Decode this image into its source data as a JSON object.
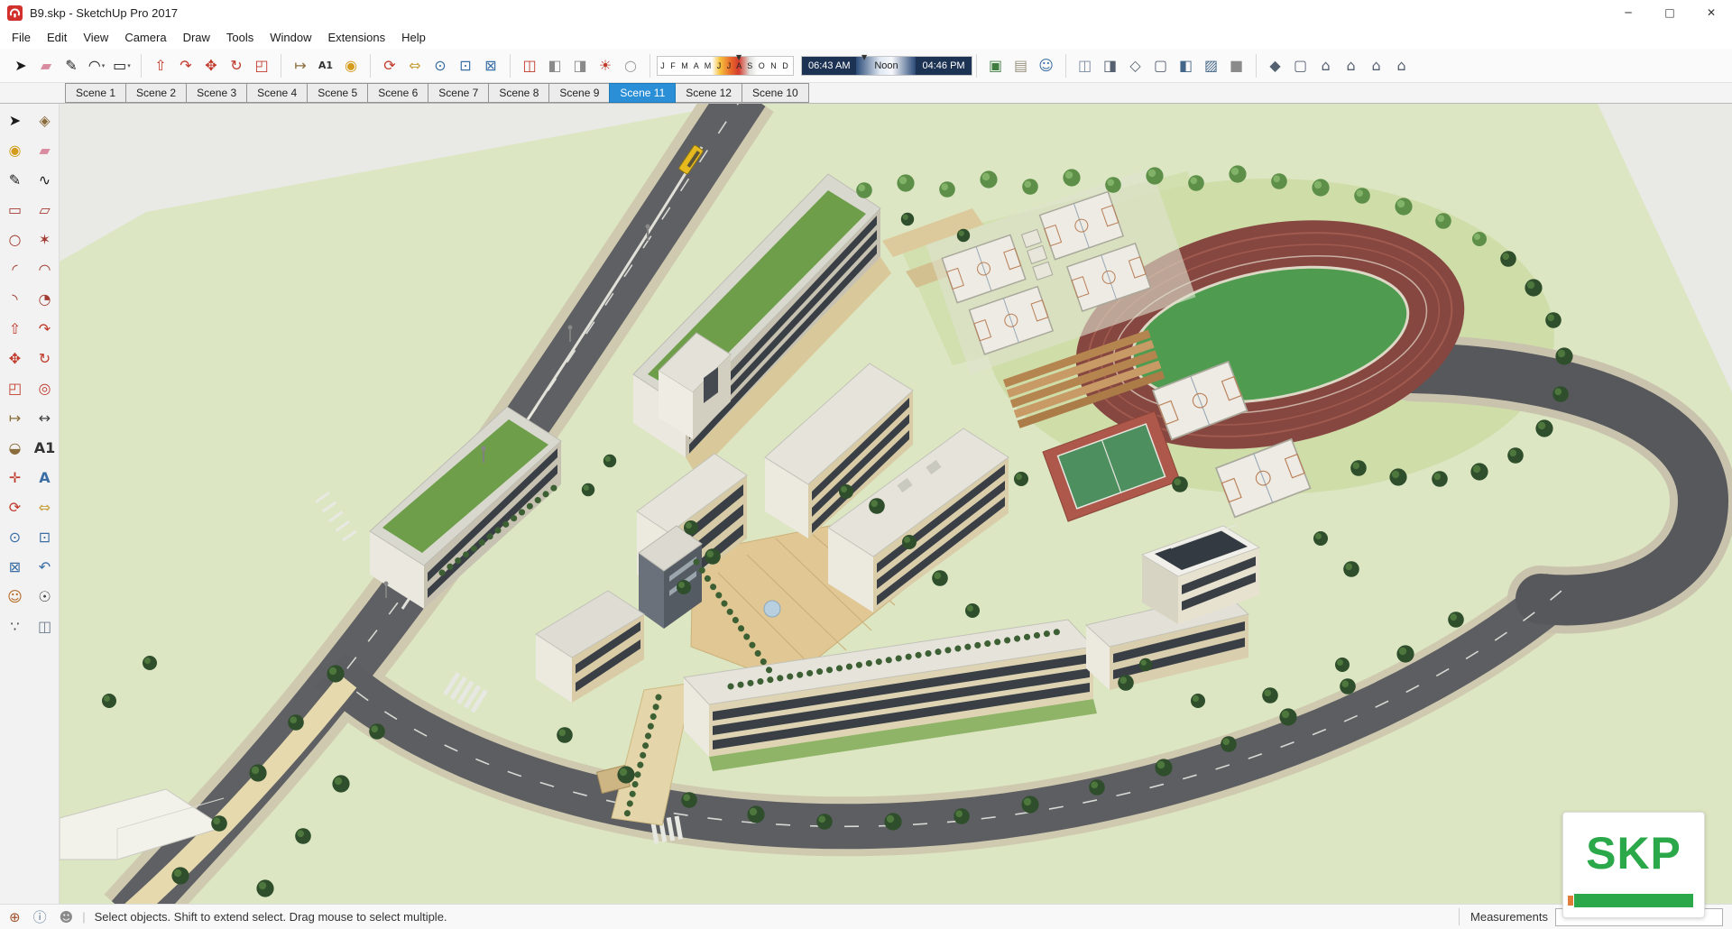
{
  "window": {
    "title": "B9.skp - SketchUp Pro 2017",
    "controls": [
      {
        "name": "minimize-button",
        "glyph": "─"
      },
      {
        "name": "maximize-button",
        "glyph": "□"
      },
      {
        "name": "close-button",
        "glyph": "✕"
      }
    ]
  },
  "menu_bar": {
    "items": [
      {
        "name": "menu-file",
        "label": "File"
      },
      {
        "name": "menu-edit",
        "label": "Edit"
      },
      {
        "name": "menu-view",
        "label": "View"
      },
      {
        "name": "menu-camera",
        "label": "Camera"
      },
      {
        "name": "menu-draw",
        "label": "Draw"
      },
      {
        "name": "menu-tools",
        "label": "Tools"
      },
      {
        "name": "menu-window",
        "label": "Window"
      },
      {
        "name": "menu-extensions",
        "label": "Extensions"
      },
      {
        "name": "menu-help",
        "label": "Help"
      }
    ]
  },
  "top_toolbar": {
    "basic": [
      {
        "name": "select-tool",
        "glyph": "➤",
        "color": "#1a1a1a"
      },
      {
        "name": "eraser-tool",
        "glyph": "▰",
        "color": "#d98ca0"
      },
      {
        "name": "line-tool",
        "glyph": "✎",
        "color": "#1a1a1a"
      },
      {
        "name": "arc-tool",
        "glyph": "◠",
        "color": "#1a1a1a",
        "caret": "▾"
      },
      {
        "name": "shapes-tool",
        "glyph": "▭",
        "color": "#1a1a1a",
        "caret": "▾"
      }
    ],
    "modify": [
      {
        "name": "push-pull-tool",
        "glyph": "⇧",
        "color": "#c0392b"
      },
      {
        "name": "follow-me-tool",
        "glyph": "↷",
        "color": "#c0392b"
      },
      {
        "name": "move-tool",
        "glyph": "✥",
        "color": "#c0392b"
      },
      {
        "name": "rotate-tool",
        "glyph": "↻",
        "color": "#c0392b"
      },
      {
        "name": "scale-tool",
        "glyph": "◰",
        "color": "#c0392b"
      }
    ],
    "construction": [
      {
        "name": "tape-measure-tool",
        "glyph": "↦",
        "color": "#8a6d3b"
      },
      {
        "name": "text-tool",
        "glyph": "A1",
        "color": "#333333"
      },
      {
        "name": "paint-bucket-tool",
        "glyph": "◉",
        "color": "#d49c1a"
      }
    ],
    "camera": [
      {
        "name": "orbit-tool",
        "glyph": "⟳",
        "color": "#c0392b"
      },
      {
        "name": "pan-tool",
        "glyph": "⇔",
        "color": "#c8a23c"
      },
      {
        "name": "zoom-tool",
        "glyph": "⊙",
        "color": "#3a6ea5"
      },
      {
        "name": "zoom-window-tool",
        "glyph": "⊡",
        "color": "#3a6ea5"
      },
      {
        "name": "zoom-extents-tool",
        "glyph": "⊠",
        "color": "#3a6ea5"
      }
    ],
    "section": [
      {
        "name": "section-plane-tool",
        "glyph": "◫",
        "color": "#c0392b"
      },
      {
        "name": "section-display-toggle",
        "glyph": "◧",
        "color": "#8a8a8a"
      },
      {
        "name": "section-cut-toggle",
        "glyph": "◨",
        "color": "#8a8a8a"
      },
      {
        "name": "shadows-toggle",
        "glyph": "☀",
        "color": "#c0392b"
      },
      {
        "name": "fog-toggle",
        "glyph": "○",
        "color": "#999999"
      }
    ],
    "shadow": {
      "months": "J F M A M J J A S O N D",
      "time_start": "06:43 AM",
      "noon": "Noon",
      "time_end": "04:46 PM"
    },
    "location": [
      {
        "name": "add-location-button",
        "glyph": "▣",
        "color": "#3f7d3f"
      },
      {
        "name": "toggle-terrain-button",
        "glyph": "▤",
        "color": "#98917e"
      },
      {
        "name": "photo-textures-button",
        "glyph": "☺",
        "color": "#3a6ea5"
      }
    ],
    "styles": [
      {
        "name": "style-xray",
        "glyph": "◫",
        "color": "#7a8aa0"
      },
      {
        "name": "style-back-edges",
        "glyph": "◨",
        "color": "#556070"
      },
      {
        "name": "style-wireframe",
        "glyph": "◇",
        "color": "#556070"
      },
      {
        "name": "style-hidden-line",
        "glyph": "▢",
        "color": "#556070"
      },
      {
        "name": "style-shaded",
        "glyph": "◧",
        "color": "#446688"
      },
      {
        "name": "style-shaded-textures",
        "glyph": "▨",
        "color": "#446688"
      },
      {
        "name": "style-monochrome",
        "glyph": "■",
        "color": "#8a8a8a"
      }
    ],
    "views": [
      {
        "name": "view-iso",
        "glyph": "◆",
        "color": "#556070"
      },
      {
        "name": "view-top",
        "glyph": "▢",
        "color": "#556070"
      },
      {
        "name": "view-front",
        "glyph": "⌂",
        "color": "#556070"
      },
      {
        "name": "view-right",
        "glyph": "⌂",
        "color": "#556070"
      },
      {
        "name": "view-back",
        "glyph": "⌂",
        "color": "#556070"
      },
      {
        "name": "view-left",
        "glyph": "⌂",
        "color": "#556070"
      }
    ]
  },
  "scene_tabs": [
    {
      "name": "scene-tab-1",
      "label": "Scene 1"
    },
    {
      "name": "scene-tab-2",
      "label": "Scene 2"
    },
    {
      "name": "scene-tab-3",
      "label": "Scene 3"
    },
    {
      "name": "scene-tab-4",
      "label": "Scene 4"
    },
    {
      "name": "scene-tab-5",
      "label": "Scene 5"
    },
    {
      "name": "scene-tab-6",
      "label": "Scene 6"
    },
    {
      "name": "scene-tab-7",
      "label": "Scene 7"
    },
    {
      "name": "scene-tab-8",
      "label": "Scene 8"
    },
    {
      "name": "scene-tab-9",
      "label": "Scene 9"
    },
    {
      "name": "scene-tab-11",
      "label": "Scene 11",
      "active": true
    },
    {
      "name": "scene-tab-12",
      "label": "Scene 12"
    },
    {
      "name": "scene-tab-10",
      "label": "Scene 10"
    }
  ],
  "left_palette": {
    "items": [
      {
        "name": "select-tool",
        "glyph": "➤",
        "color": "#1a1a1a"
      },
      {
        "name": "make-component-tool",
        "glyph": "◈",
        "color": "#8a6b3a"
      },
      {
        "name": "paint-bucket-tool",
        "glyph": "◉",
        "color": "#d49c1a"
      },
      {
        "name": "eraser-tool",
        "glyph": "▰",
        "color": "#d98ca0"
      },
      {
        "name": "line-tool",
        "glyph": "✎",
        "color": "#1a1a1a"
      },
      {
        "name": "freehand-tool",
        "glyph": "∿",
        "color": "#1a1a1a"
      },
      {
        "name": "rectangle-tool",
        "glyph": "▭",
        "color": "#a43b32"
      },
      {
        "name": "rotated-rectangle-tool",
        "glyph": "▱",
        "color": "#a43b32"
      },
      {
        "name": "circle-tool",
        "glyph": "○",
        "color": "#a43b32"
      },
      {
        "name": "polygon-tool",
        "glyph": "✶",
        "color": "#a43b32"
      },
      {
        "name": "arc-tool",
        "glyph": "◜",
        "color": "#a43b32"
      },
      {
        "name": "two-point-arc-tool",
        "glyph": "◠",
        "color": "#a43b32"
      },
      {
        "name": "three-point-arc-tool",
        "glyph": "◝",
        "color": "#a43b32"
      },
      {
        "name": "pie-tool",
        "glyph": "◔",
        "color": "#a43b32"
      },
      {
        "name": "push-pull-tool",
        "glyph": "⇧",
        "color": "#c0392b"
      },
      {
        "name": "follow-me-tool",
        "glyph": "↷",
        "color": "#c0392b"
      },
      {
        "name": "move-tool",
        "glyph": "✥",
        "color": "#c0392b"
      },
      {
        "name": "rotate-tool",
        "glyph": "↻",
        "color": "#c0392b"
      },
      {
        "name": "scale-tool",
        "glyph": "◰",
        "color": "#c0392b"
      },
      {
        "name": "offset-tool",
        "glyph": "◎",
        "color": "#c0392b"
      },
      {
        "name": "tape-measure-tool",
        "glyph": "↦",
        "color": "#8a6d3b"
      },
      {
        "name": "dimension-tool",
        "glyph": "↔",
        "color": "#444444"
      },
      {
        "name": "protractor-tool",
        "glyph": "◒",
        "color": "#8a6d3b"
      },
      {
        "name": "text-tool",
        "glyph": "A1",
        "color": "#333333"
      },
      {
        "name": "axes-tool",
        "glyph": "✛",
        "color": "#c0392b"
      },
      {
        "name": "three-d-text-tool",
        "glyph": "A",
        "color": "#3a6ea5"
      },
      {
        "name": "orbit-tool",
        "glyph": "⟳",
        "color": "#c0392b"
      },
      {
        "name": "pan-tool",
        "glyph": "⇔",
        "color": "#c8a23c"
      },
      {
        "name": "zoom-tool",
        "glyph": "⊙",
        "color": "#3a6ea5"
      },
      {
        "name": "zoom-window-tool",
        "glyph": "⊡",
        "color": "#3a6ea5"
      },
      {
        "name": "zoom-extents-tool",
        "glyph": "⊠",
        "color": "#3a6ea5"
      },
      {
        "name": "zoom-previous-tool",
        "glyph": "↶",
        "color": "#3a6ea5"
      },
      {
        "name": "position-camera-tool",
        "glyph": "☺",
        "color": "#b5651d"
      },
      {
        "name": "look-around-tool",
        "glyph": "☉",
        "color": "#444444"
      },
      {
        "name": "walk-tool",
        "glyph": "∵",
        "color": "#444444"
      },
      {
        "name": "section-plane-tool",
        "glyph": "◫",
        "color": "#6a7a8a"
      }
    ]
  },
  "statusbar": {
    "icons": [
      {
        "name": "geolocation-icon",
        "glyph": "⊕",
        "color": "#a0522d"
      },
      {
        "name": "credits-icon",
        "glyph": "ⓘ",
        "color": "#5a7a9a"
      },
      {
        "name": "sign-in-icon",
        "glyph": "☻",
        "color": "#8a8a8a"
      }
    ],
    "hint": "Select objects. Shift to extend select. Drag mouse to select multiple.",
    "measurements_label": "Measurements",
    "measurements_value": ""
  },
  "watermark": {
    "text": "SKP"
  },
  "colors": {
    "active_tab": "#2b8fd8",
    "terrain": "#dce6c2",
    "track_field": "#4f9c50",
    "track_surface": "#864640",
    "road": "#5f6063",
    "watermark_green": "#2ba84a"
  }
}
